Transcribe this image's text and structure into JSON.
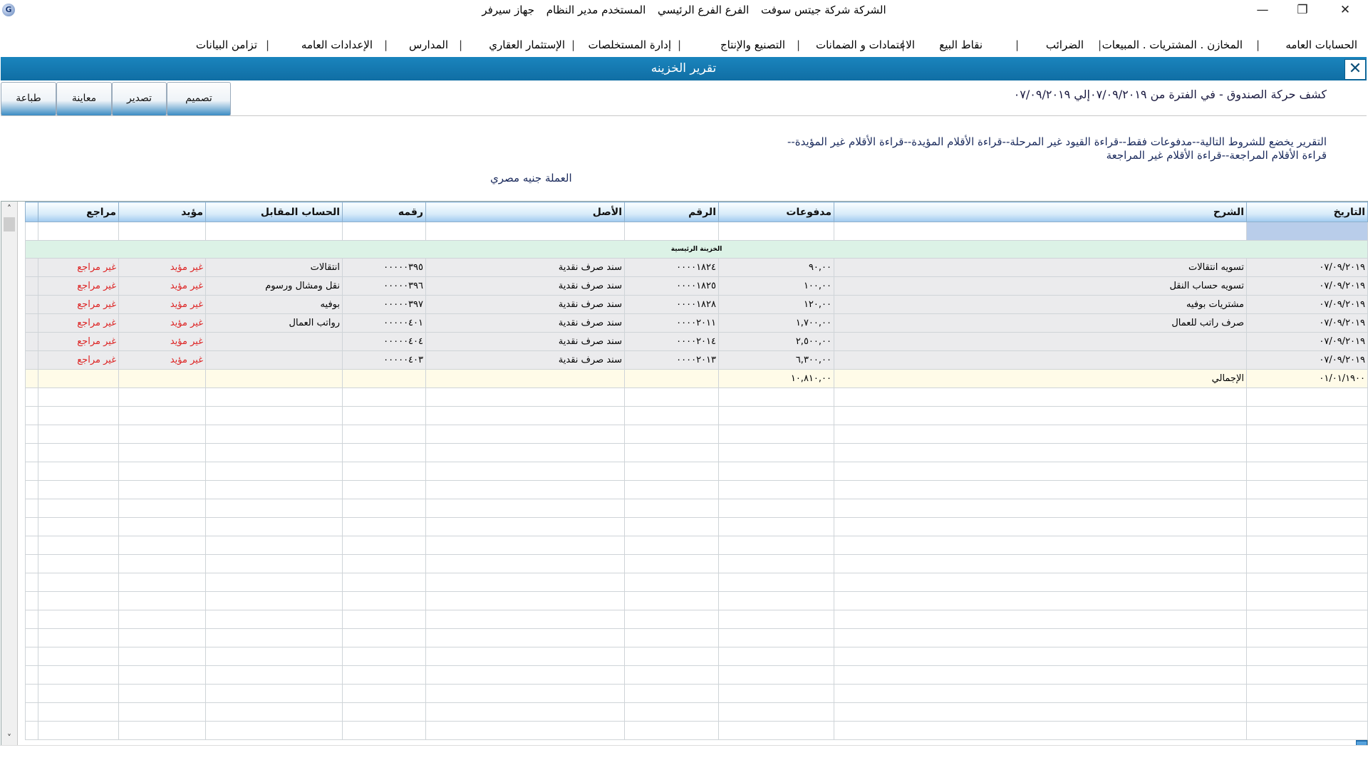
{
  "titlebar": {
    "company": "الشركة شركة جيتس سوفت",
    "branch": "الفرع الفرع الرئيسي",
    "user": "المستخدم مدير النظام",
    "device": "جهاز سيرفر",
    "minimize": "—",
    "restore": "❐",
    "close": "✕"
  },
  "menu": [
    "الحسابات العامه",
    "المخازن . المشتريات . المبيعات",
    "الضرائب",
    "نقاط البيع",
    "الاعتمادات و الضمانات",
    "التصنيع والإنتاج",
    "إدارة المستخلصات",
    "الإستثمار العقاري",
    "المدارس",
    "الإعدادات العامه",
    "تزامن البيانات"
  ],
  "menu_separator": "|",
  "banner": {
    "title": "تقرير الخزينه",
    "close": "✕"
  },
  "toolbar": {
    "design": "تصميم",
    "export": "تصدير",
    "preview": "معاينة",
    "print": "طباعة"
  },
  "report": {
    "title": "كشف حركة الصندوق -    في الفترة من ٠٧/٠٩/٢٠١٩إلي ٠٧/٠٩/٢٠١٩",
    "conditions": "التقرير يخضع للشروط التالية--مدفوعات فقط--قراءة القيود غير المرحلة--قراءة الأقلام المؤيدة--قراءة الأقلام غير المؤيدة--قراءة الأقلام المراجعة--قراءة الأقلام غير المراجعة",
    "currency": "العملة جنيه مصري"
  },
  "columns": {
    "date": "التاريخ",
    "description": "الشرح",
    "payments": "مدفوعات",
    "number": "الرقم",
    "origin": "الأصل",
    "ref": "رقمه",
    "counter_account": "الحساب المقابل",
    "approved": "مؤيد",
    "reviewed": "مراجع"
  },
  "group_label": "الخزينة الرئيسية",
  "rows": [
    {
      "date": "٠٧/٠٩/٢٠١٩",
      "description": "تسويه انتقالات",
      "payments": "٩٠,٠٠",
      "number": "٠٠٠٠١٨٢٤",
      "origin": "سند صرف نقدية",
      "ref": "٠٠٠٠٠٣٩٥",
      "counter_account": "انتقالات",
      "approved": "غير مؤيد",
      "reviewed": "غير مراجع"
    },
    {
      "date": "٠٧/٠٩/٢٠١٩",
      "description": "تسويه حساب النقل",
      "payments": "١٠٠,٠٠",
      "number": "٠٠٠٠١٨٢٥",
      "origin": "سند صرف نقدية",
      "ref": "٠٠٠٠٠٣٩٦",
      "counter_account": "نقل ومشال ورسوم",
      "approved": "غير مؤيد",
      "reviewed": "غير مراجع"
    },
    {
      "date": "٠٧/٠٩/٢٠١٩",
      "description": "مشتريات بوفيه",
      "payments": "١٢٠,٠٠",
      "number": "٠٠٠٠١٨٢٨",
      "origin": "سند صرف نقدية",
      "ref": "٠٠٠٠٠٣٩٧",
      "counter_account": "بوفيه",
      "approved": "غير مؤيد",
      "reviewed": "غير مراجع"
    },
    {
      "date": "٠٧/٠٩/٢٠١٩",
      "description": "صرف راتب للعمال",
      "payments": "١,٧٠٠,٠٠",
      "number": "٠٠٠٠٢٠١١",
      "origin": "سند صرف نقدية",
      "ref": "٠٠٠٠٠٤٠١",
      "counter_account": "رواتب العمال",
      "approved": "غير مؤيد",
      "reviewed": "غير مراجع"
    },
    {
      "date": "٠٧/٠٩/٢٠١٩",
      "description": "",
      "payments": "٢,٥٠٠,٠٠",
      "number": "٠٠٠٠٢٠١٤",
      "origin": "سند صرف نقدية",
      "ref": "٠٠٠٠٠٤٠٤",
      "counter_account": "",
      "approved": "غير مؤيد",
      "reviewed": "غير مراجع"
    },
    {
      "date": "٠٧/٠٩/٢٠١٩",
      "description": "",
      "payments": "٦,٣٠٠,٠٠",
      "number": "٠٠٠٠٢٠١٣",
      "origin": "سند صرف نقدية",
      "ref": "٠٠٠٠٠٤٠٣",
      "counter_account": "",
      "approved": "غير مؤيد",
      "reviewed": "غير مراجع"
    }
  ],
  "total": {
    "date": "٠١/٠١/١٩٠٠",
    "label": "الإجمالي",
    "payments": "١٠,٨١٠,٠٠"
  },
  "scroll": {
    "up": "˄",
    "down": "˅"
  },
  "icons": {
    "app": "app-logo-icon"
  }
}
